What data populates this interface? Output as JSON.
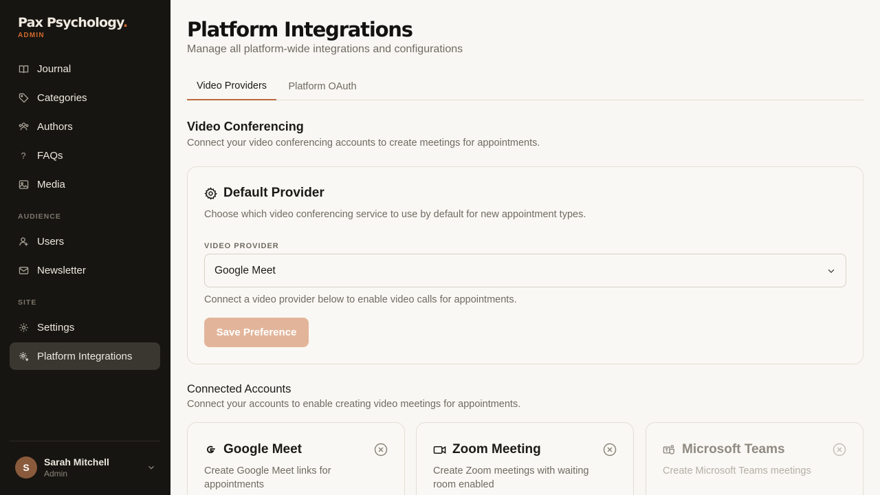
{
  "brand": {
    "name": "Pax Psychology",
    "dot": ".",
    "subtitle": "ADMIN"
  },
  "sidebar": {
    "items": [
      {
        "label": "Journal",
        "icon": "book-icon"
      },
      {
        "label": "Categories",
        "icon": "tag-icon"
      },
      {
        "label": "Authors",
        "icon": "users-icon"
      },
      {
        "label": "FAQs",
        "icon": "question-icon"
      },
      {
        "label": "Media",
        "icon": "image-icon"
      }
    ],
    "section_audience": "AUDIENCE",
    "audience_items": [
      {
        "label": "Users",
        "icon": "user-icon"
      },
      {
        "label": "Newsletter",
        "icon": "mail-icon"
      }
    ],
    "section_site": "SITE",
    "site_items": [
      {
        "label": "Settings",
        "icon": "gear-icon"
      },
      {
        "label": "Platform Integrations",
        "icon": "gear-plus-icon",
        "active": true
      }
    ]
  },
  "user": {
    "initial": "S",
    "name": "Sarah Mitchell",
    "role": "Admin"
  },
  "page": {
    "title": "Platform Integrations",
    "subtitle": "Manage all platform-wide integrations and configurations"
  },
  "tabs": [
    {
      "label": "Video Providers",
      "active": true
    },
    {
      "label": "Platform OAuth",
      "active": false
    }
  ],
  "video": {
    "title": "Video Conferencing",
    "subtitle": "Connect your video conferencing accounts to create meetings for appointments."
  },
  "default_provider": {
    "title": "Default Provider",
    "description": "Choose which video conferencing service to use by default for new appointment types.",
    "field_label": "VIDEO PROVIDER",
    "selected": "Google Meet",
    "hint": "Connect a video provider below to enable video calls for appointments.",
    "save_label": "Save Preference"
  },
  "connected": {
    "title": "Connected Accounts",
    "subtitle": "Connect your accounts to enable creating video meetings for appointments."
  },
  "providers": [
    {
      "name": "Google Meet",
      "description": "Create Google Meet links for appointments",
      "icon": "google-icon"
    },
    {
      "name": "Zoom Meeting",
      "description": "Create Zoom meetings with waiting room enabled",
      "icon": "video-camera-icon"
    },
    {
      "name": "Microsoft Teams",
      "description": "Create Microsoft Teams meetings",
      "icon": "teams-icon",
      "disabled": true
    }
  ],
  "colors": {
    "accent": "#d0692e",
    "sidebar_bg": "#171511",
    "button": "#e2b59a",
    "tab_underline": "#b8683d"
  }
}
